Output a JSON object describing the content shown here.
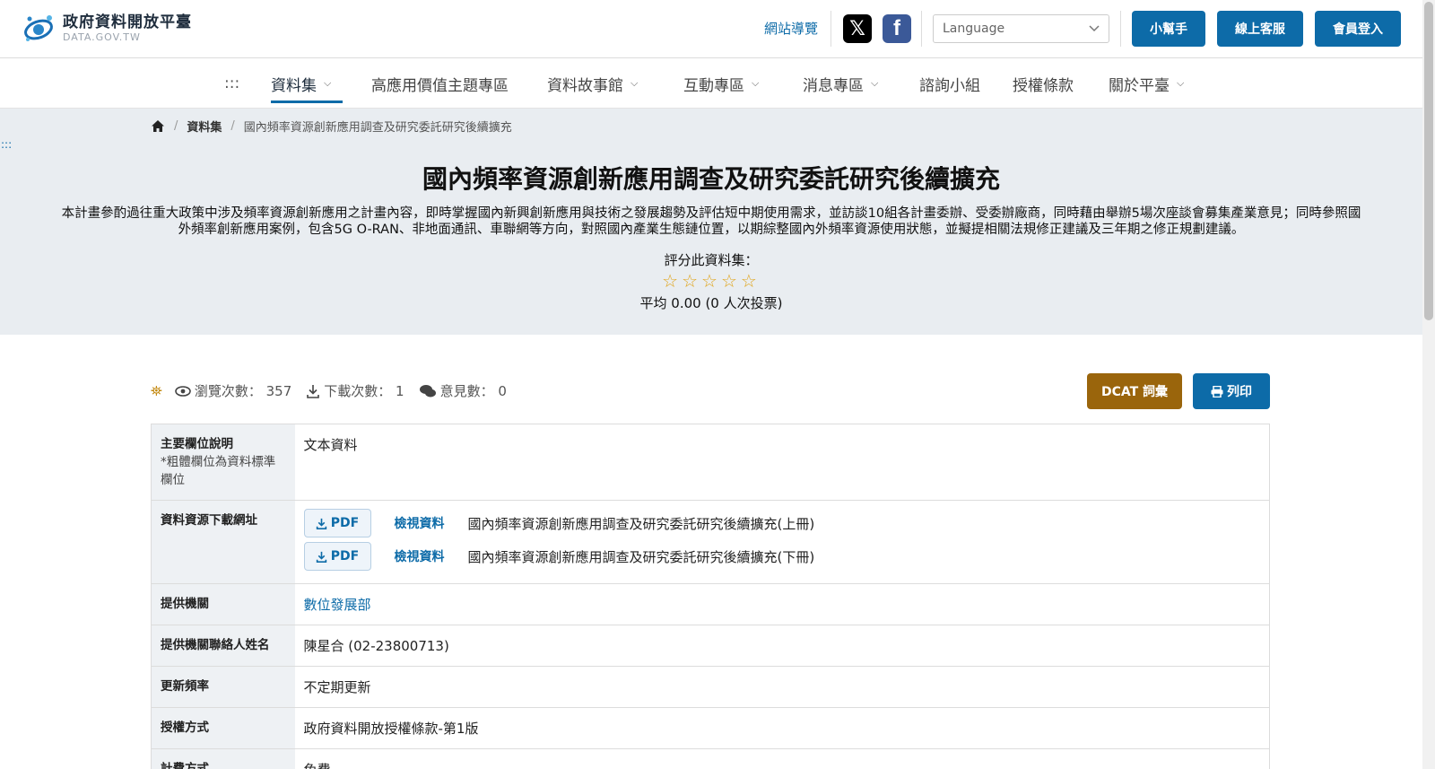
{
  "header": {
    "logo_title": "政府資料開放平臺",
    "logo_sub": "DATA.GOV.TW",
    "sitemap": "網站導覽",
    "social_x": "𝕏",
    "social_fb": "f",
    "language_placeholder": "Language",
    "helper_button": "小幫手",
    "service_button": "線上客服",
    "login_button": "會員登入"
  },
  "nav": {
    "menu_dots": ":::",
    "items": [
      {
        "label": "資料集",
        "dropdown": true,
        "active": true
      },
      {
        "label": "高應用價值主題專區",
        "dropdown": false
      },
      {
        "label": "資料故事館",
        "dropdown": true
      },
      {
        "label": "互動專區",
        "dropdown": true
      },
      {
        "label": "消息專區",
        "dropdown": true
      },
      {
        "label": "諮詢小組",
        "dropdown": false
      },
      {
        "label": "授權條款",
        "dropdown": false
      },
      {
        "label": "關於平臺",
        "dropdown": true
      }
    ]
  },
  "breadcrumb": {
    "home_icon": "home-icon",
    "level1": "資料集",
    "current": "國內頻率資源創新應用調查及研究委託研究後續擴充"
  },
  "accessibility_anchor": ":::",
  "dataset": {
    "title": "國內頻率資源創新應用調查及研究委託研究後續擴充",
    "description": "本計畫參酌過往重大政策中涉及頻率資源創新應用之計畫內容，即時掌握國內新興創新應用與技術之發展趨勢及評估短中期使用需求，並訪談10組各計畫委辦、受委辦廠商，同時藉由舉辦5場次座談會募集產業意見；同時參照國外頻率創新應用案例，包含5G O-RAN、非地面通訊、車聯網等方向，對照國內產業生態鏈位置，以期綜整國內外頻率資源使用狀態，並擬提相關法規修正建議及三年期之修正規劃建議。",
    "rating_label": "評分此資料集：",
    "stars": "☆☆☆☆☆",
    "rating_value": 0,
    "rating_avg": "平均 0.00 (0 人次投票)"
  },
  "stats": {
    "views_label": "瀏覽次數：",
    "views": "357",
    "downloads_label": "下載次數：",
    "downloads": "1",
    "comments_label": "意見數：",
    "comments": "0",
    "dcat_button": "DCAT 詞彙",
    "print_button": "列印"
  },
  "details": {
    "main_fields_label": "主要欄位說明",
    "main_fields_note": "*粗體欄位為資料標準欄位",
    "main_fields_value": "文本資料",
    "resources_label": "資料資源下載網址",
    "resources": [
      {
        "format": "PDF",
        "view": "檢視資料",
        "name": "國內頻率資源創新應用調查及研究委託研究後續擴充(上冊)"
      },
      {
        "format": "PDF",
        "view": "檢視資料",
        "name": "國內頻率資源創新應用調查及研究委託研究後續擴充(下冊)"
      }
    ],
    "org_label": "提供機關",
    "org_value": "數位發展部",
    "contact_label": "提供機關聯絡人姓名",
    "contact_value": "陳星合 (02-23800713)",
    "frequency_label": "更新頻率",
    "frequency_value": "不定期更新",
    "license_label": "授權方式",
    "license_value": "政府資料開放授權條款-第1版",
    "fee_label": "計費方式",
    "fee_value": "免費"
  }
}
